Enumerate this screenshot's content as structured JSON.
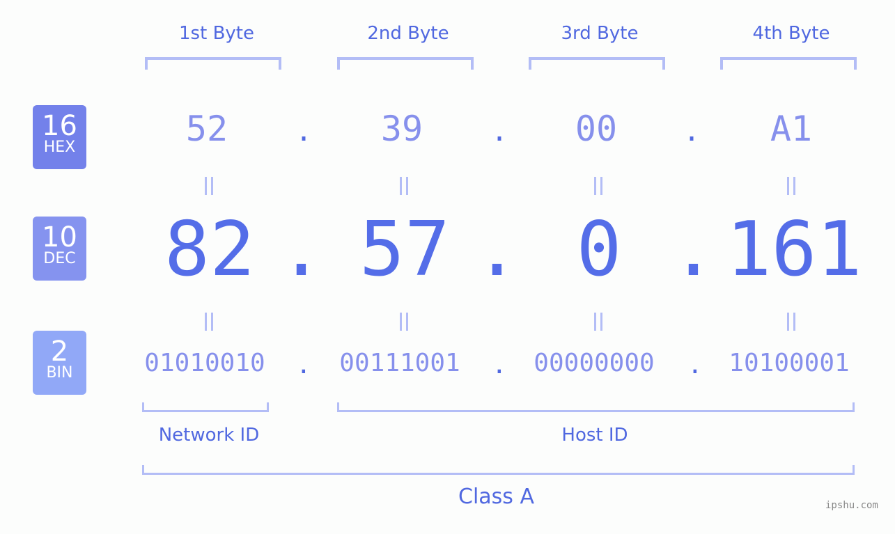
{
  "byte_headers": [
    "1st Byte",
    "2nd Byte",
    "3rd Byte",
    "4th Byte"
  ],
  "rows": {
    "hex": {
      "base": "16",
      "label": "HEX",
      "color": "#7381ea",
      "values": [
        "52",
        "39",
        "00",
        "A1"
      ]
    },
    "dec": {
      "base": "10",
      "label": "DEC",
      "color": "#8593ef",
      "values": [
        "82",
        "57",
        "0",
        "161"
      ]
    },
    "bin": {
      "base": "2",
      "label": "BIN",
      "color": "#91a8f7",
      "values": [
        "01010010",
        "00111001",
        "00000000",
        "10100001"
      ]
    }
  },
  "separator": ".",
  "groups": {
    "network": "Network ID",
    "host": "Host ID",
    "class": "Class A"
  },
  "watermark": "ipshu.com",
  "colors": {
    "accent": "#546de8",
    "muted": "#8690ec",
    "bracket": "#b3bdf6"
  }
}
